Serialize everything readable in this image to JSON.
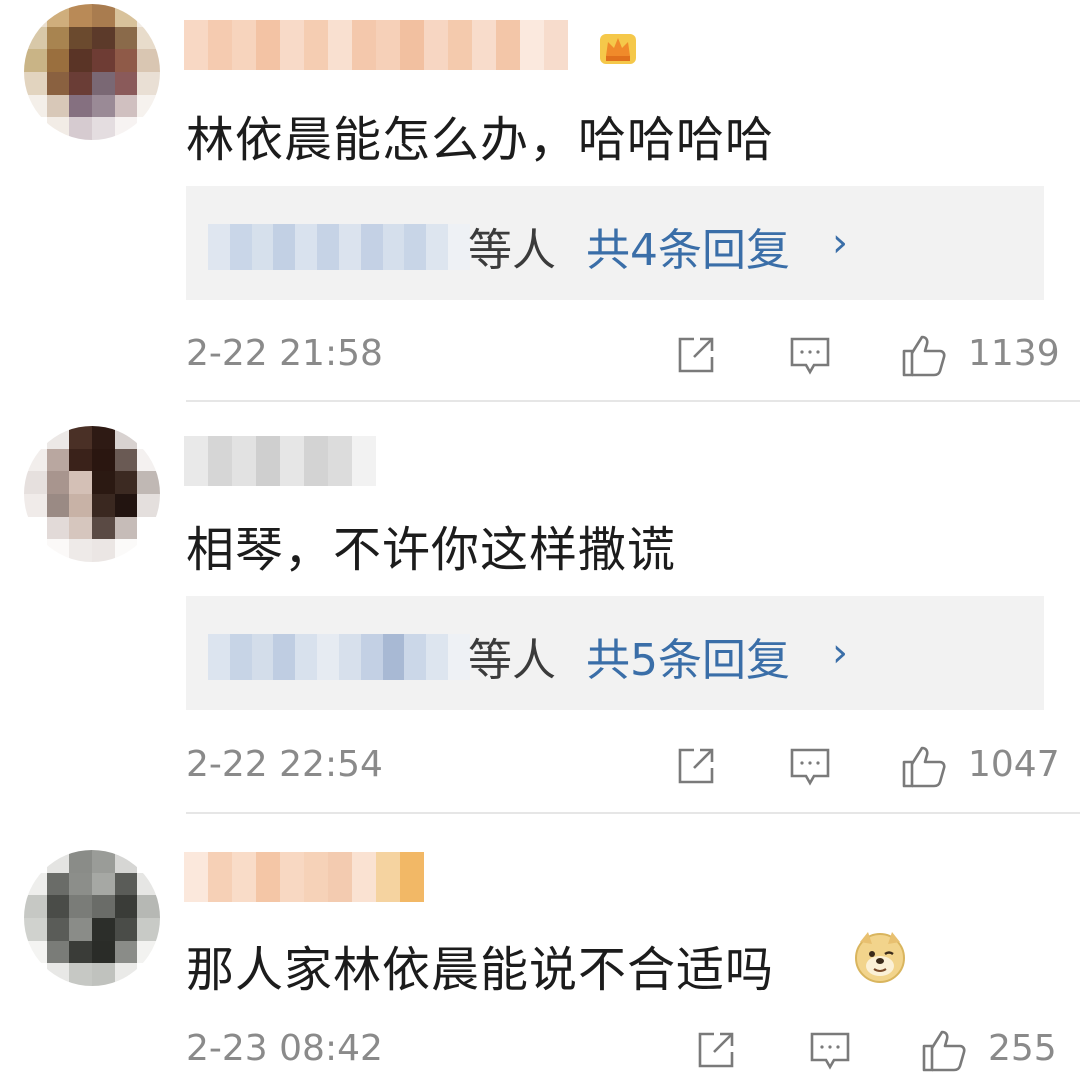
{
  "comments": [
    {
      "text": "林依晨能怎么办，哈哈哈哈",
      "reply_suffix": "等人",
      "reply_count": "共4条回复",
      "chevron": "›",
      "time": "2-22 21:58",
      "likes": "1139",
      "badge": "vip-crown-icon"
    },
    {
      "text": "相琴，不许你这样撒谎",
      "reply_suffix": "等人",
      "reply_count": "共5条回复",
      "chevron": "›",
      "time": "2-22 22:54",
      "likes": "1047"
    },
    {
      "text": "那人家林依晨能说不合适吗",
      "emoji": "doge-emoji-icon",
      "time": "2-23 08:42",
      "likes": "255"
    }
  ],
  "icons": {
    "share": "share-icon",
    "comment": "comment-icon",
    "like": "thumbs-up-icon"
  },
  "colors": {
    "link": "#3a6ea8",
    "meta": "#8a8a8a",
    "reply_bg": "#f2f2f2"
  }
}
